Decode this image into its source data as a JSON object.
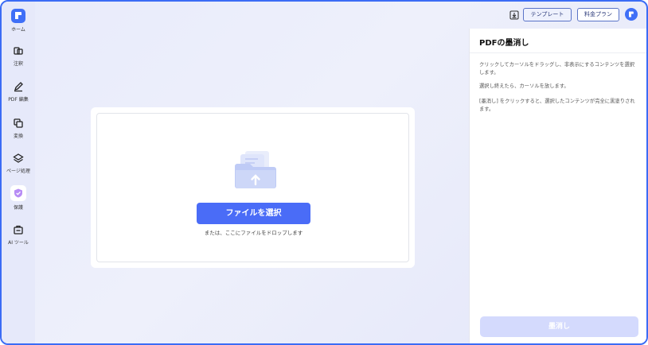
{
  "sidebar": {
    "home_label": "ホーム",
    "items": [
      {
        "label": "注釈",
        "icon": "annotate-icon"
      },
      {
        "label": "PDF 編集",
        "icon": "pen-edit-icon"
      },
      {
        "label": "変換",
        "icon": "convert-icon"
      },
      {
        "label": "ページ処理",
        "icon": "layers-icon"
      },
      {
        "label": "保護",
        "icon": "shield-check-icon",
        "active": true
      },
      {
        "label": "AI ツール",
        "icon": "ai-toolbox-icon"
      }
    ]
  },
  "topbar": {
    "download_icon": "download-icon",
    "template_label": "テンプレート",
    "pricing_label": "料金プラン"
  },
  "upload": {
    "select_button": "ファイルを選択",
    "hint": "または、ここにファイルをドロップします"
  },
  "panel": {
    "title": "PDFの墨消し",
    "para1": "クリックしてカーソルをドラッグし、非表示にするコンテンツを選択します。",
    "para2": "選択し終えたら、カーソルを放します。",
    "para3": "[墨消し] をクリックすると、選択したコンテンツが完全に黒塗りされます。",
    "redact_button": "墨消し"
  },
  "colors": {
    "accent": "#4a6cf7",
    "frame": "#3b6cf5",
    "disabled_button": "#d4dafd"
  }
}
